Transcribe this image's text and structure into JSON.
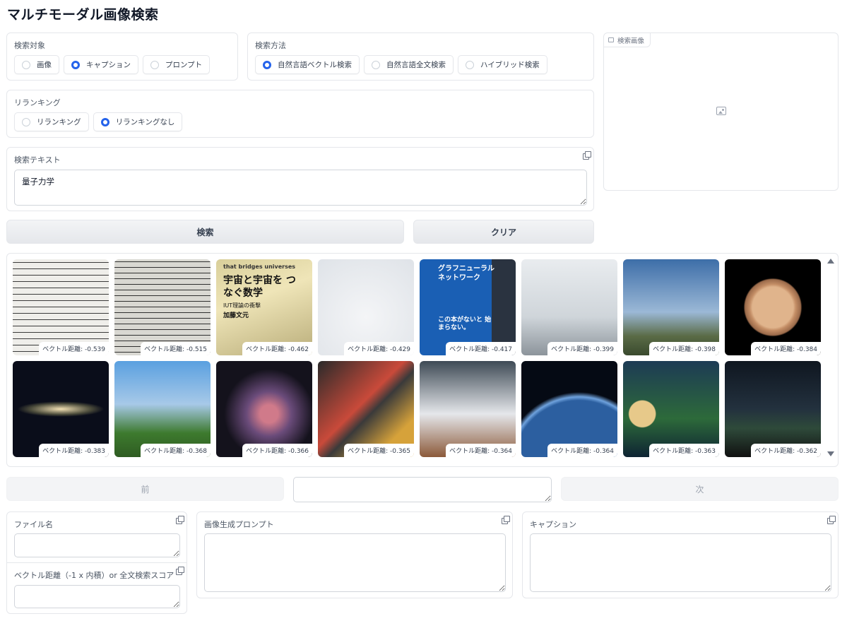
{
  "app": {
    "title": "マルチモーダル画像検索"
  },
  "target": {
    "label": "検索対象",
    "options": [
      {
        "label": "画像",
        "checked": false
      },
      {
        "label": "キャプション",
        "checked": true
      },
      {
        "label": "プロンプト",
        "checked": false
      }
    ]
  },
  "method": {
    "label": "検索方法",
    "options": [
      {
        "label": "自然言語ベクトル検索",
        "checked": true
      },
      {
        "label": "自然言語全文検索",
        "checked": false
      },
      {
        "label": "ハイブリッド検索",
        "checked": false
      }
    ]
  },
  "rerank": {
    "label": "リランキング",
    "options": [
      {
        "label": "リランキング",
        "checked": false
      },
      {
        "label": "リランキングなし",
        "checked": true
      }
    ]
  },
  "query": {
    "label": "検索テキスト",
    "value": "量子力学"
  },
  "search_image": {
    "label": "検索画像"
  },
  "actions": {
    "search": "検索",
    "clear": "クリア"
  },
  "results": [
    {
      "caption": "ベクトル距離: -0.539",
      "kind": "notes"
    },
    {
      "caption": "ベクトル距離: -0.515",
      "kind": "notes2"
    },
    {
      "caption": "ベクトル距離: -0.462",
      "kind": "book1"
    },
    {
      "caption": "ベクトル距離: -0.429",
      "kind": "shirt"
    },
    {
      "caption": "ベクトル距離: -0.417",
      "kind": "book2"
    },
    {
      "caption": "ベクトル距離: -0.399",
      "kind": "robot"
    },
    {
      "caption": "ベクトル距離: -0.398",
      "kind": "rockets"
    },
    {
      "caption": "ベクトル距離: -0.384",
      "kind": "jupiter"
    },
    {
      "caption": "ベクトル距離: -0.383",
      "kind": "galaxy"
    },
    {
      "caption": "ベクトル距離: -0.368",
      "kind": "city"
    },
    {
      "caption": "ベクトル距離: -0.366",
      "kind": "nebula"
    },
    {
      "caption": "ベクトル距離: -0.365",
      "kind": "circuit"
    },
    {
      "caption": "ベクトル距離: -0.364",
      "kind": "model"
    },
    {
      "caption": "ベクトル距離: -0.364",
      "kind": "earth"
    },
    {
      "caption": "ベクトル距離: -0.363",
      "kind": "moon"
    },
    {
      "caption": "ベクトル距離: -0.362",
      "kind": "night"
    }
  ],
  "book1_text": {
    "top": "that bridges universes",
    "main": "宇宙と宇宙を つなぐ数学",
    "sub": "IUT理論の衝撃",
    "author": "加藤文元"
  },
  "book2_text": {
    "main": "グラフニューラル ネットワーク",
    "sub": "この本がないと 始まらない。"
  },
  "pager": {
    "prev": "前",
    "next": "次",
    "page_value": ""
  },
  "details": {
    "filename_label": "ファイル名",
    "filename_value": "",
    "score_label": "ベクトル距離（-1 x 内積）or 全文検索スコア",
    "score_value": "",
    "prompt_label": "画像生成プロンプト",
    "prompt_value": "",
    "caption_label": "キャプション",
    "caption_value": ""
  }
}
